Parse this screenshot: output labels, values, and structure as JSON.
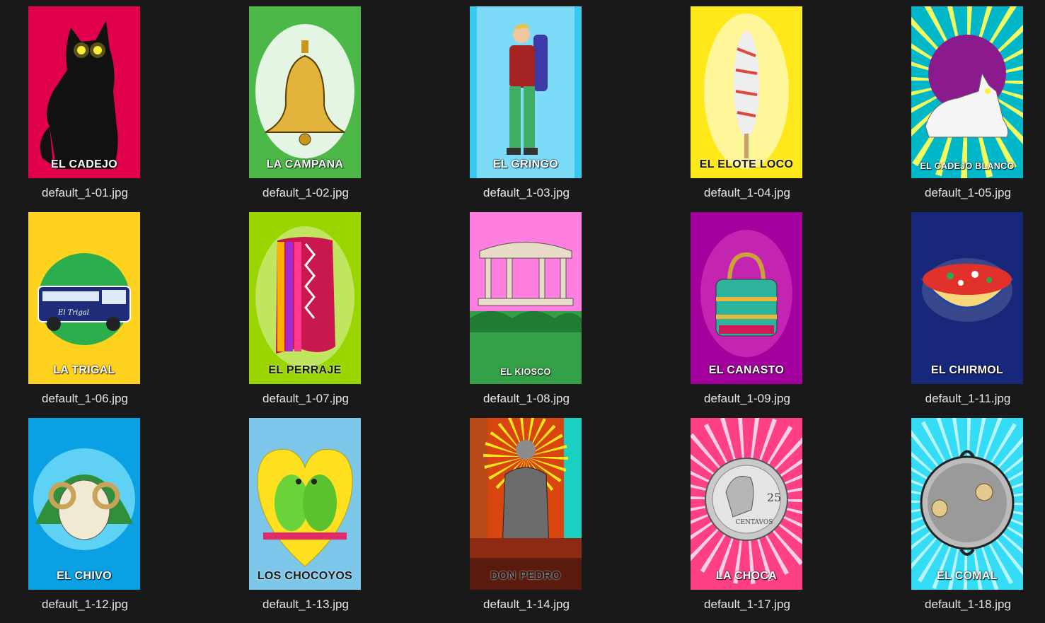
{
  "files": [
    {
      "name": "default_1-01.jpg",
      "label": "EL CADEJO",
      "bg": "#e0004d"
    },
    {
      "name": "default_1-02.jpg",
      "label": "LA CAMPANA",
      "bg": "#4cb848"
    },
    {
      "name": "default_1-03.jpg",
      "label": "EL GRINGO",
      "bg": "#38c8f0"
    },
    {
      "name": "default_1-04.jpg",
      "label": "EL ELOTE LOCO",
      "bg": "#ffe81a"
    },
    {
      "name": "default_1-05.jpg",
      "label": "EL CADEJO BLANCO",
      "bg": "#00b7c9"
    },
    {
      "name": "default_1-06.jpg",
      "label": "LA TRIGAL",
      "bg": "#ffd21f",
      "bus_text": "El Trigal"
    },
    {
      "name": "default_1-07.jpg",
      "label": "EL PERRAJE",
      "bg": "#9ad500"
    },
    {
      "name": "default_1-08.jpg",
      "label": "EL KIOSCO",
      "bg": "#ff7fe0"
    },
    {
      "name": "default_1-09.jpg",
      "label": "EL CANASTO",
      "bg": "#a3009d"
    },
    {
      "name": "default_1-11.jpg",
      "label": "EL CHIRMOL",
      "bg": "#17287a"
    },
    {
      "name": "default_1-12.jpg",
      "label": "EL CHIVO",
      "bg": "#0aa0e3"
    },
    {
      "name": "default_1-13.jpg",
      "label": "LOS CHOCOYOS",
      "bg": "#7cc6ea"
    },
    {
      "name": "default_1-14.jpg",
      "label": "DON PEDRO",
      "bg": "#d8450f"
    },
    {
      "name": "default_1-17.jpg",
      "label": "LA CHOCA",
      "bg": "#ff3f86",
      "coin_value": "25",
      "coin_text": "CENTAVOS"
    },
    {
      "name": "default_1-18.jpg",
      "label": "EL COMAL",
      "bg": "#34dcf6"
    }
  ]
}
